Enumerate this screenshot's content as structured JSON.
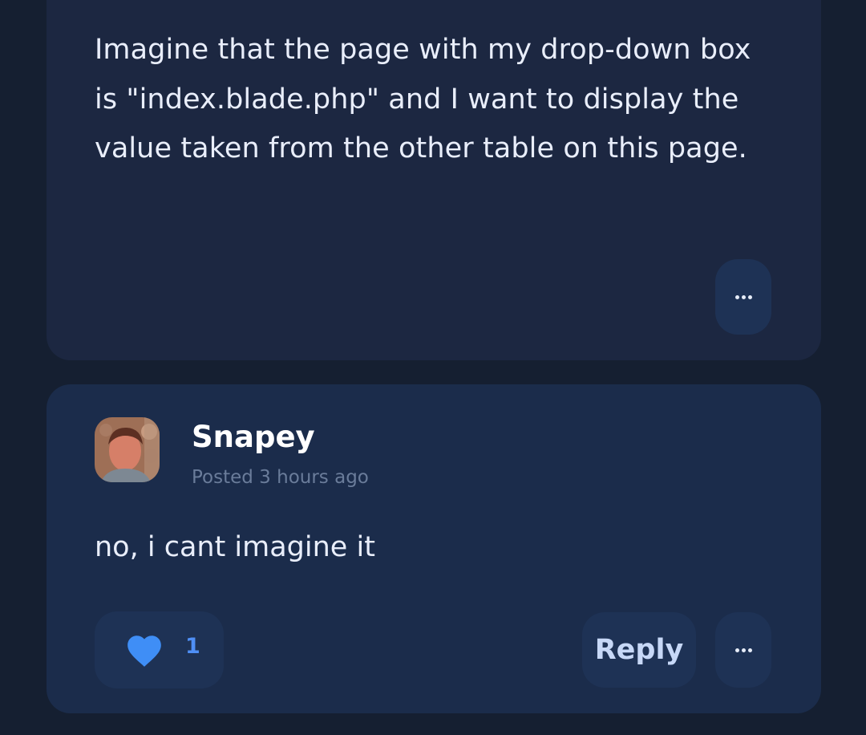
{
  "question": {
    "body": "Imagine that the page with my drop-down box is \"index.blade.php\" and I want to display the value taken from the other table on this page.",
    "more_icon": "more-horizontal-icon"
  },
  "reply": {
    "author": "Snapey",
    "posted": "Posted 3 hours ago",
    "body": "no, i cant imagine it",
    "likes": "1",
    "like_icon": "heart-icon",
    "reply_label": "Reply",
    "more_icon": "more-horizontal-icon"
  },
  "colors": {
    "page_bg": "#151f31",
    "card_bg": "#1c2741",
    "reply_card_bg": "#1b2c4b",
    "button_bg": "#1e3255",
    "accent": "#4f8ff5",
    "text": "#e9eefb",
    "muted": "#6a7c9a"
  }
}
